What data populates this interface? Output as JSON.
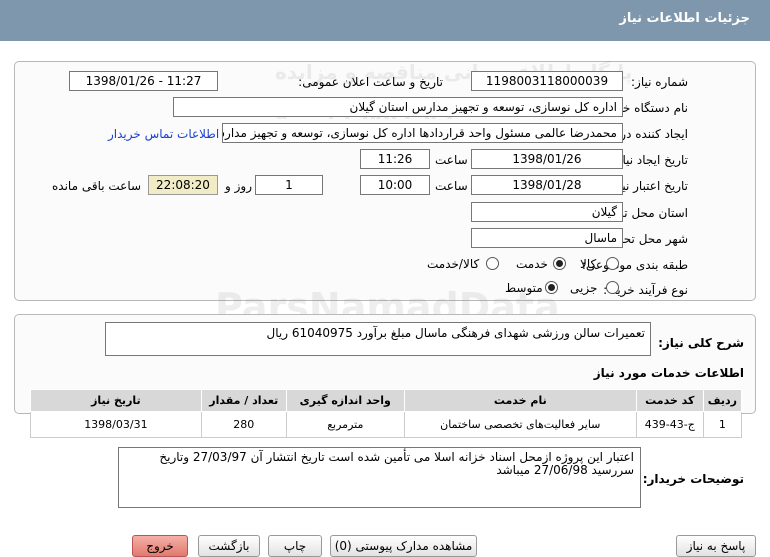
{
  "header": {
    "title": "جزئیات اطلاعات نیاز"
  },
  "watermark": {
    "line1": "ParsNamadData",
    "line2": "مرکز فراوری اطلاعات پارس نماد داده ها",
    "line3": "پایگاه اطلاع رسانی مناقصه و مزایده",
    "line4": "۰۲۱-۸۸۳۴۹۶۷۰ - ۵"
  },
  "info": {
    "need_number_label": "شماره نیاز:",
    "need_number": "1198003118000039",
    "announce_label": "تاریخ و ساعت اعلان عمومی:",
    "announce_value": "1398/01/26 - 11:27",
    "buyer_label": "نام دستگاه خریدار:",
    "buyer_value": "اداره کل نوسازی، توسعه و تجهیز مدارس استان گیلان",
    "creator_label": "ایجاد کننده درخواست:",
    "creator_value": "محمدرضا عالمی مسئول واحد قراردادها اداره کل نوسازی، توسعه و تجهیز مدارس",
    "contact_link": "اطلاعات تماس خریدار",
    "create_date_label": "تاریخ ایجاد نیاز:",
    "create_date": "1398/01/26",
    "time_label": "ساعت",
    "create_time": "11:26",
    "validity_label": "تاریخ اعتبار نیاز:",
    "validity_date": "1398/01/28",
    "validity_time": "10:00",
    "days_value": "1",
    "days_label": "روز و",
    "remaining_value": "22:08:20",
    "remaining_label": "ساعت باقی مانده",
    "province_label": "استان محل تحویل:",
    "province_value": "گیلان",
    "city_label": "شهر محل تحویل:",
    "city_value": "ماسال",
    "category_label": "طبقه بندی موضوعی:",
    "category_options": [
      "کالا",
      "خدمت",
      "کالا/خدمت"
    ],
    "category_selected": "خدمت",
    "purchase_label": "نوع فرآیند خرید :",
    "purchase_options": [
      "جزیی",
      "متوسط"
    ],
    "purchase_selected": "متوسط"
  },
  "general": {
    "label": "شرح کلی نیاز:",
    "value": "تعمیرات سالن ورزشی شهدای فرهنگی ماسال مبلغ برآورد 61040975 ریال"
  },
  "services": {
    "title": "اطلاعات خدمات مورد نیاز",
    "columns": [
      "ردیف",
      "کد خدمت",
      "نام خدمت",
      "واحد اندازه گیری",
      "تعداد / مقدار",
      "تاریخ نیاز"
    ],
    "rows": [
      [
        "1",
        "ج-43-439",
        "سایر فعالیت‌های تخصصی ساختمان",
        "مترمربع",
        "280",
        "1398/03/31"
      ]
    ]
  },
  "notes": {
    "label": "توضیحات خریدار:",
    "value": "اعتبار این پروژه ازمحل اسناد خزانه اسلا می تأمین شده است تاریخ انتشار آن 27/03/97 وتاریخ سررسید 27/06/98 میباشد"
  },
  "buttons": {
    "reply": "پاسخ به نیاز",
    "docs": "مشاهده مدارک پیوستی (0)",
    "print": "چاپ",
    "back": "بازگشت",
    "exit": "خروج"
  }
}
